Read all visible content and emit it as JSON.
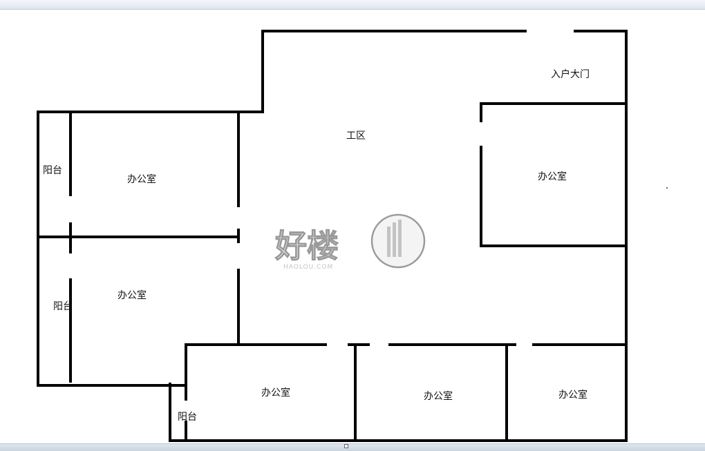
{
  "rooms": {
    "entrance": "入户大门",
    "work_area": "工区",
    "office_left_top": "办公室",
    "office_left_bottom": "办公室",
    "office_right": "办公室",
    "office_bottom_1": "办公室",
    "office_bottom_2": "办公室",
    "office_bottom_3": "办公室",
    "balcony_top": "阳台",
    "balcony_middle": "阳台",
    "balcony_bottom": "阳台"
  },
  "watermark": {
    "brand": "好楼",
    "url": "HAOLOU.COM"
  }
}
